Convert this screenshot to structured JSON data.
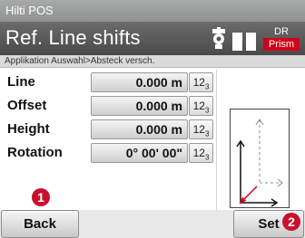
{
  "window": {
    "title": "Hilti POS"
  },
  "header": {
    "title": "Ref. Line shifts",
    "target_icon": "prism-target-icon",
    "battery_icon": "battery-icon",
    "mode_top": "DR",
    "mode_bottom": "Prism",
    "accent_color": "#d0021b"
  },
  "breadcrumb": "Applikation Auswahl>Absteck versch.",
  "fields": [
    {
      "label": "Line",
      "value": "0.000 m"
    },
    {
      "label": "Offset",
      "value": "0.000 m"
    },
    {
      "label": "Height",
      "value": "0.000 m"
    },
    {
      "label": "Rotation",
      "value": "0° 00' 00\""
    }
  ],
  "keypad_label": {
    "main": "12",
    "sub": "3"
  },
  "buttons": {
    "back": "Back",
    "set": "Set"
  },
  "callouts": {
    "one": "1",
    "two": "2"
  }
}
